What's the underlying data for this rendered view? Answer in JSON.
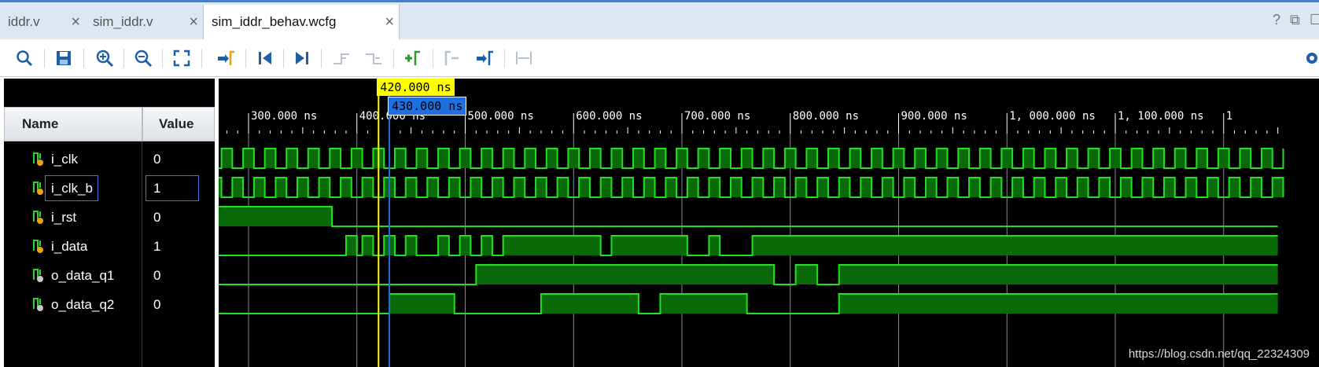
{
  "tabs": [
    {
      "label": "iddr.v",
      "close": "×",
      "active": false
    },
    {
      "label": "sim_iddr.v",
      "close": "×",
      "active": false
    },
    {
      "label": "sim_iddr_behav.wcfg",
      "close": "×",
      "active": true
    }
  ],
  "window_buttons": {
    "help": "?",
    "restore": "⧉",
    "maximize": "☐"
  },
  "toolbar_icons": [
    "search-icon",
    "save-icon",
    "zoom-in-icon",
    "zoom-out-icon",
    "zoom-fit-icon",
    "go-to-cursor-icon",
    "go-to-time-0-icon",
    "go-to-last-time-icon",
    "previous-transition-icon",
    "next-transition-icon",
    "add-marker-icon",
    "previous-marker-icon",
    "next-marker-icon",
    "swap-cursors-icon",
    "settings-icon"
  ],
  "columns": {
    "name": "Name",
    "value": "Value"
  },
  "signals": [
    {
      "name": "i_clk",
      "value": "0",
      "type": "input"
    },
    {
      "name": "i_clk_b",
      "value": "1",
      "type": "input",
      "selected": true
    },
    {
      "name": "i_rst",
      "value": "0",
      "type": "input"
    },
    {
      "name": "i_data",
      "value": "1",
      "type": "input"
    },
    {
      "name": "o_data_q1",
      "value": "0",
      "type": "output"
    },
    {
      "name": "o_data_q2",
      "value": "0",
      "type": "output"
    }
  ],
  "timeline": {
    "unit": "ns",
    "range_ns": [
      240,
      1250
    ],
    "major_ticks": [
      {
        "t": 300,
        "label": "300.000 ns"
      },
      {
        "t": 400,
        "label": "400.000 ns"
      },
      {
        "t": 500,
        "label": "500.000 ns"
      },
      {
        "t": 600,
        "label": "600.000 ns"
      },
      {
        "t": 700,
        "label": "700.000 ns"
      },
      {
        "t": 800,
        "label": "800.000 ns"
      },
      {
        "t": 900,
        "label": "900.000 ns"
      },
      {
        "t": 1000,
        "label": "1, 000.000 ns"
      },
      {
        "t": 1100,
        "label": "1, 100.000 ns"
      },
      {
        "t": 1200,
        "label": "1"
      }
    ]
  },
  "cursors": {
    "primary": {
      "t": 420,
      "label": "420.000 ns",
      "color": "#ffff00"
    },
    "secondary": {
      "t": 430,
      "label": "430.000 ns",
      "color": "#1f6fe0"
    }
  },
  "waves": {
    "i_clk": {
      "kind": "clock",
      "period": 20,
      "start": 245,
      "first_high": false
    },
    "i_clk_b": {
      "kind": "clock",
      "period": 20,
      "start": 245,
      "first_high": true
    },
    "i_rst": {
      "kind": "level",
      "segments": [
        [
          242,
          377,
          1
        ],
        [
          377,
          1250,
          0
        ]
      ]
    },
    "i_data": {
      "kind": "level",
      "segments": [
        [
          242,
          390,
          0
        ],
        [
          390,
          400,
          1
        ],
        [
          400,
          405,
          0
        ],
        [
          405,
          415,
          1
        ],
        [
          415,
          425,
          0
        ],
        [
          425,
          435,
          1
        ],
        [
          435,
          445,
          0
        ],
        [
          445,
          455,
          1
        ],
        [
          455,
          475,
          0
        ],
        [
          475,
          485,
          1
        ],
        [
          485,
          495,
          0
        ],
        [
          495,
          505,
          1
        ],
        [
          505,
          515,
          0
        ],
        [
          515,
          525,
          1
        ],
        [
          525,
          535,
          0
        ],
        [
          535,
          625,
          1
        ],
        [
          625,
          635,
          0
        ],
        [
          635,
          705,
          1
        ],
        [
          705,
          725,
          0
        ],
        [
          725,
          735,
          1
        ],
        [
          735,
          765,
          0
        ],
        [
          765,
          1250,
          1
        ]
      ]
    },
    "o_data_q1": {
      "kind": "level",
      "segments": [
        [
          242,
          510,
          0
        ],
        [
          510,
          785,
          1
        ],
        [
          785,
          805,
          0
        ],
        [
          805,
          825,
          1
        ],
        [
          825,
          845,
          0
        ],
        [
          845,
          1250,
          1
        ]
      ]
    },
    "o_data_q2": {
      "kind": "level",
      "segments": [
        [
          242,
          242,
          1
        ],
        [
          242,
          430,
          0
        ],
        [
          430,
          490,
          1
        ],
        [
          490,
          570,
          0
        ],
        [
          570,
          660,
          1
        ],
        [
          660,
          680,
          0
        ],
        [
          680,
          760,
          1
        ],
        [
          760,
          845,
          0
        ],
        [
          845,
          1250,
          1
        ]
      ]
    }
  },
  "colors": {
    "wave": "#20e020",
    "wave_fill": "#0a6a0a",
    "background": "#000000",
    "tab_bar": "#dde6f1"
  },
  "watermark": "https://blog.csdn.net/qq_22324309"
}
